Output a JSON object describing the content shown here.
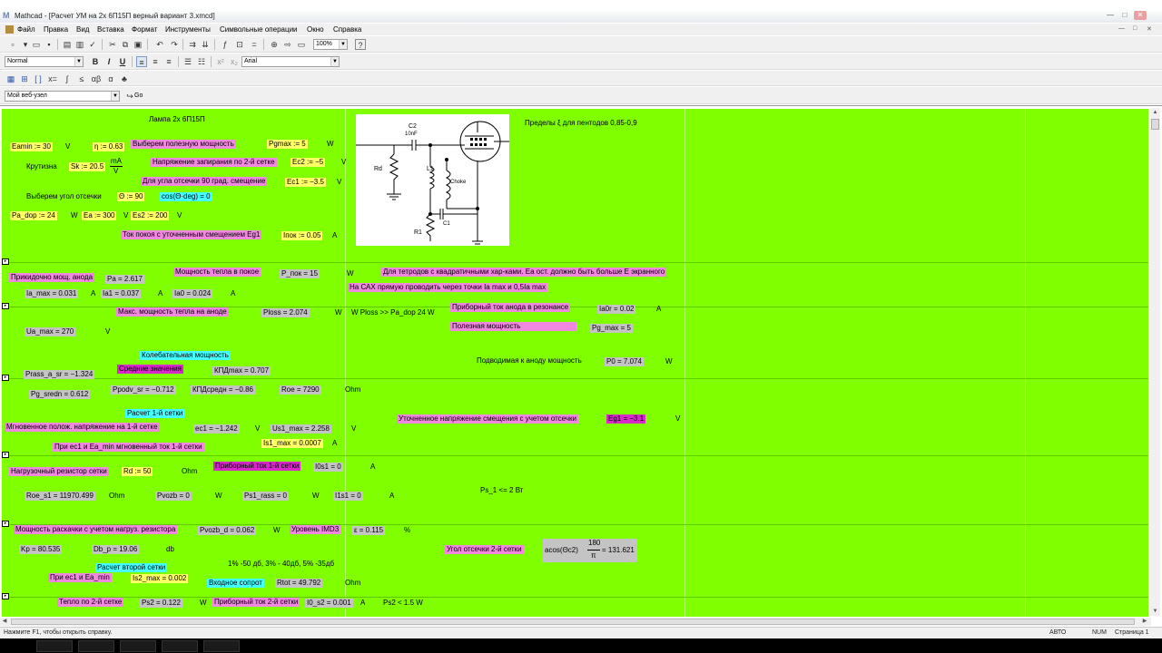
{
  "window": {
    "app_icon": "M",
    "title": "Mathcad - [Расчет УМ на 2х 6П15П  верный вариант 3.xmcd]",
    "min": "—",
    "max": "□",
    "close": "✕"
  },
  "menu": {
    "items": [
      "Файл",
      "Правка",
      "Вид",
      "Вставка",
      "Формат",
      "Инструменты",
      "Символьные операции",
      "Окно",
      "Справка"
    ]
  },
  "toolbar": {
    "zoom": "100%",
    "style": "Normal",
    "font": "Arial",
    "bold": "B",
    "italic": "I",
    "underline": "U",
    "address": "Мой веб-узел",
    "go": "Go",
    "standard_icons": [
      "new-icon",
      "open-icon",
      "save-icon",
      "print-icon",
      "preview-icon",
      "spellcheck-icon",
      "cut-icon",
      "copy-icon",
      "paste-icon",
      "undo-icon",
      "redo-icon",
      "align-icon",
      "insert-graph-icon",
      "matrix-icon",
      "function-icon",
      "unit-icon",
      "calculate-icon",
      "component-icon",
      "help-icon"
    ]
  },
  "worksheet": {
    "caption_tube": "Лампа 2х 6П15П",
    "caption_limits": "Пределы ξ для пентодов  0,85-0,9",
    "eamin": "Eamin := 30",
    "unit_eamin": "V",
    "eta": "η := 0.63",
    "choose_power": "Выберем полезную мощность",
    "pgmax": "Pgmax := 5",
    "unit_pgmax": "W",
    "slope_label": "Крутизна",
    "sk": "Sk := 20.5",
    "sk_unit_top": "mA",
    "sk_unit_bottom": "V",
    "cutoff_voltage_label": "Напряжение запирания по 2-й сетке",
    "ec2": "Ec2 := −5",
    "unit_ec2": "V",
    "cutoff_angle_label": "Для угла отсечки 90 град. смещение",
    "ec1": "Ec1 := −3.5",
    "unit_ec1": "V",
    "choose_angle": "Выберем угол отсечки",
    "theta": "Θ := 90",
    "cos_theta": "cos(Θ·deg) = 0",
    "pa_dop": "Pa_dop := 24",
    "unit_pa_dop": "W",
    "ea": "Ea := 300",
    "unit_ea": "V",
    "es2": "Es2 := 200",
    "unit_es2": "V",
    "quiescent_label": "Ток покоя с уточненным смещением Eg1",
    "ipok": "Iпок := 0.05",
    "unit_ipok": "A",
    "approx_anode_label": "Прикидочно мощ. анода",
    "pa": "Pa = 2.617",
    "heat_rest_label": "Мощность тепла в покое",
    "p_pok": "P_пок = 15",
    "unit_p_pok": "W",
    "tetrode_note": "Для тетродов с квадратичными хар-ками. Ea ост. должно быть больше E экранного",
    "cax_note": "На САХ прямую проводить через точки Ia max  и 0,5Ia max",
    "ia_max": "Ia_max = 0.031",
    "unit_ia_max": "A",
    "ia1": "Ia1 = 0.037",
    "unit_ia1": "A",
    "ia0": "Ia0 = 0.024",
    "unit_ia0": "A",
    "max_heat_label": "Макс. мощность тепла на аноде",
    "ploss": "Ploss = 2.074",
    "unit_ploss": "W",
    "ploss_note": "W  Ploss >> Pa_dop 24 W",
    "meter_anode_label": "Приборный ток анода  в резонансе",
    "ia0r": "Ia0r = 0.02",
    "unit_ia0r": "A",
    "useful_label": "Полезная мощность",
    "pg_max": "Pg_max = 5",
    "ua_max": "Ua_max = 270",
    "unit_ua_max": "V",
    "osc_power_label": "Колебательная мощность",
    "supplied_label": "Подводимая к аноду мощность",
    "p0": "P0 = 7.074",
    "unit_p0": "W",
    "prass": "Prass_a_sr = −1.324",
    "avg_values_label": "Средние значения",
    "kpd_max": "КПДmax = 0.707",
    "pg_sredn": "Pg_sredn = 0.612",
    "ppodv": "Ppodv_sr = −0.712",
    "kpd_sred": "КПДсредн = −0.86",
    "roe": "Roe = 7290",
    "unit_roe": "Ohm",
    "grid1_calc_label": "Расчет 1-й сетки",
    "refined_bias_label": "Уточненное напряжение смещения с учетом отсечки",
    "eg1": "Eg1 = −3.1",
    "unit_eg1": "V",
    "inst_voltage_label": "Мгновенное полож. напряжение на 1-й сетке",
    "ec1_calc": "ec1 = −1.242",
    "unit_ec1_calc": "V",
    "us1_max": "Us1_max = 2.258",
    "unit_us1_max": "V",
    "inst_current_label": "При ec1  и Ea_min мгновенный ток 1-й сетки",
    "is1_max": "Is1_max = 0.0007",
    "unit_is1_max": "A",
    "load_res_label": "Нагрузочный резистор сетки",
    "rd": "Rd := 50",
    "unit_rd": "Ohm",
    "meter_grid1_label": "Приборный ток 1-й сетки",
    "i0s1": "I0s1 = 0",
    "unit_i0s1": "A",
    "roe_s1": "Roe_s1 = 11970.499",
    "unit_roe_s1": "Ohm",
    "pvozb": "Pvozb = 0",
    "unit_pvozb": "W",
    "ps1_rass": "Ps1_rass = 0",
    "unit_ps1_rass": "W",
    "i1s1": "I1s1 = 0",
    "unit_i1s1": "A",
    "ps1_note": "Ps_1 <= 2 Вт",
    "drive_power_label": "Мощность раскачки с учетом нагруз. резистора",
    "pvozb_d": "Pvozb_d = 0.062",
    "unit_pvozb_d": "W",
    "imd_label": "Уровень IMD3",
    "epsilon": "ε = 0.115",
    "unit_epsilon": "%",
    "kp": "Kp = 80.535",
    "db_p": "Db_p = 19.06",
    "unit_db_p": "db",
    "grid2_angle_label": "Угол отсечки 2-й сетки",
    "acos_expr": "acos(Θc2)",
    "acos_num": "180",
    "acos_den": "π",
    "acos_result": "= 131.621",
    "imd_note": "1% -50 дб, 3% - 40дб, 5% -35дб",
    "grid2_calc_label": "Расчет второй сетки",
    "at_ec1_label": "При ec1 и Ea_min",
    "is2_max": "Is2_max = 0.002",
    "input_res_label": "Входное сопрот",
    "rtot": "Rtot = 49.792",
    "unit_rtot": "Ohm",
    "heat_grid2_label": "Тепло по 2-й сетке",
    "ps2": "Ps2 = 0.122",
    "unit_ps2": "W",
    "meter_grid2_label": "Приборный ток 2-й сетки",
    "i0_s2": "I0_s2 = 0.001",
    "unit_i0_s2": "A",
    "ps2_note": "Ps2 < 1.5 W"
  },
  "schematic": {
    "c2_label": "C2",
    "c2_value": "10nF",
    "rd_label": "Rd",
    "l1_label": "L1",
    "choke_label": "Choke",
    "c1_label": "C1",
    "r1_label": "R1"
  },
  "status": {
    "help_text": "Нажмите F1, чтобы открыть справку.",
    "mode": "АВТО",
    "num": "NUM",
    "page": "Страница 1"
  }
}
